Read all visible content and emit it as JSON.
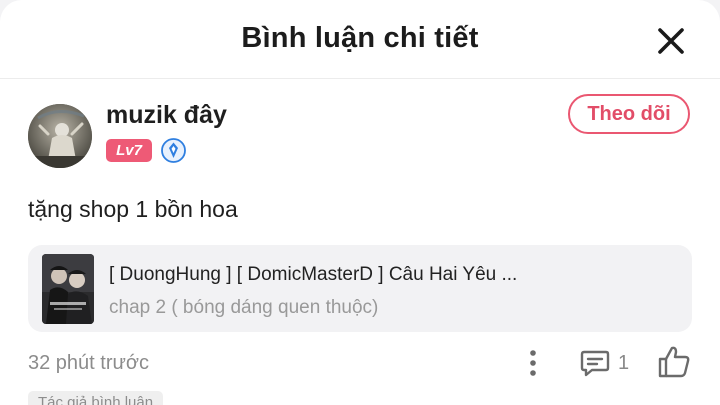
{
  "header": {
    "title": "Bình luận chi tiết"
  },
  "user": {
    "name": "muzik đây",
    "level": "Lv7",
    "follow_label": "Theo dõi"
  },
  "comment": {
    "text": "tặng shop 1 bồn hoa",
    "timestamp": "32 phút trước",
    "reply_count": "1",
    "author_tag": "Tác giả bình luận"
  },
  "manga": {
    "title": "[ DuongHung ] [ DomicMasterD ] Câu Hai Yêu ...",
    "chapter": "chap 2 ( bóng dáng quen thuộc)"
  },
  "colors": {
    "accent": "#ea5771",
    "level_badge": "#ee5a76",
    "rank_icon": "#2f7fe0"
  },
  "icons": {
    "close": "close-icon",
    "rank": "rank-badge-icon",
    "more": "more-vertical-icon",
    "reply": "comment-bubble-icon",
    "like": "thumbs-up-icon"
  }
}
